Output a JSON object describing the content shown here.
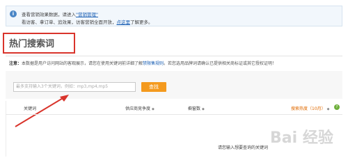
{
  "notice": {
    "line1_prefix": "查看营销效果数据，请进入",
    "line1_link": "\"营销管理\"",
    "line2_prefix": "看访客、拿订单、追效果，访客营销全面开放，",
    "line2_link": "点这里",
    "line2_suffix": "了解更多。"
  },
  "page": {
    "title": "热门搜索词"
  },
  "note": {
    "label": "注意：",
    "text_prefix": "本数据是用户访问网站的客观展示，请您在使用关键词前详细了解",
    "link": "禁限售规则",
    "text_suffix": "。若您选用品牌词请确认已提供相关商标证或其它授权证明！"
  },
  "search": {
    "placeholder": "最多支持输入3个关键词，例如：mp3,mp4,mp5",
    "button_label": "查找"
  },
  "table": {
    "col_keyword": "关键词",
    "col_competition": "供应商竞争度",
    "col_showcase": "橱窗数",
    "col_popularity": "搜索热度（10月）",
    "sort_glyph": "◆",
    "help_glyph": "?",
    "empty_message": "请您输入想要查询的关键词"
  },
  "icons": {
    "info": "i"
  },
  "watermark": "Bai 经验",
  "colors": {
    "accent_orange": "#f49a1e",
    "link_blue": "#1a5fb4",
    "highlight_red": "#d9342b"
  }
}
